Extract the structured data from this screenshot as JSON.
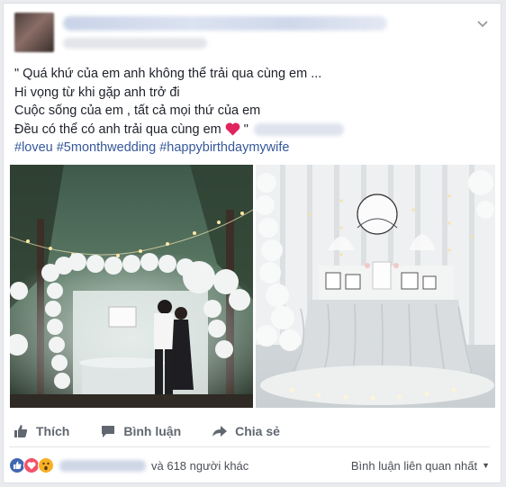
{
  "post": {
    "lines": [
      "\" Quá khứ của em anh không thể trải qua cùng em ...",
      "Hi vọng từ khi gặp anh trở đi",
      "Cuộc sống của em , tất cả mọi thứ của em",
      "Đều có thể có anh trải qua cùng em"
    ],
    "closing_quote": "\"",
    "hashtags": [
      "#loveu",
      "#5monthwedding",
      "#happybirthdaymywife"
    ]
  },
  "actions": {
    "like": "Thích",
    "comment": "Bình luận",
    "share": "Chia sẻ"
  },
  "reactions": {
    "others_text": "và 618 người khác",
    "sort_label": "Bình luận liên quan nhất"
  },
  "icons": {
    "menu": "chevron-down-icon",
    "like": "thumbs-up-icon",
    "comment": "speech-bubble-icon",
    "share": "share-arrow-icon",
    "reaction_like": "like-reaction-icon",
    "reaction_love": "love-reaction-icon",
    "reaction_wow": "wow-reaction-icon",
    "heart": "red-heart-emoji"
  },
  "colors": {
    "hashtag": "#365899",
    "heart": "#e0245e",
    "like_reaction": "#4267b2",
    "love_reaction": "#f25268",
    "wow_reaction": "#f7b125"
  }
}
